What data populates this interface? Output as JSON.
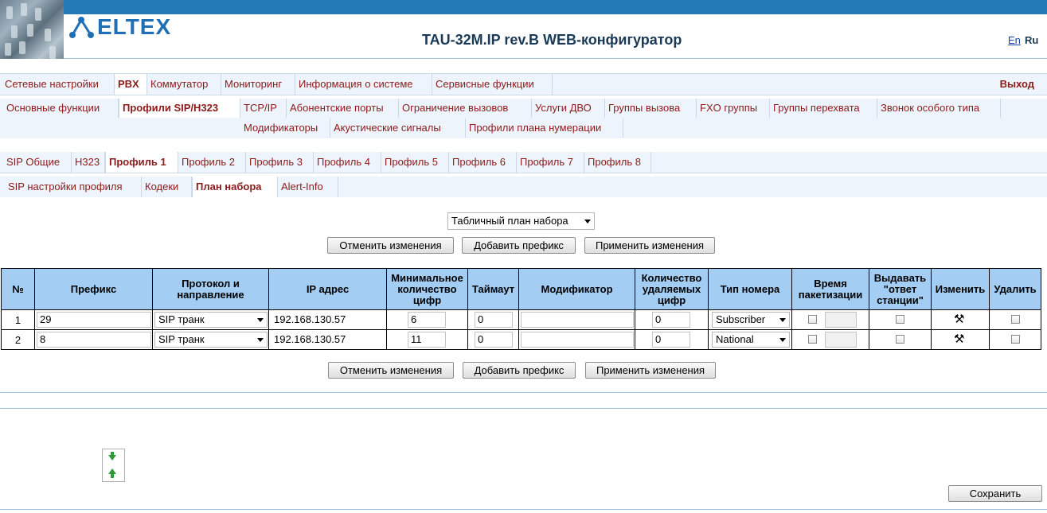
{
  "header": {
    "logo_text": "ELTEX",
    "title": "TAU-32M.IP rev.B WEB-конфигуратор",
    "lang_en": "En",
    "lang_ru": "Ru"
  },
  "main_nav": {
    "items": [
      "Сетевые настройки",
      "PBX",
      "Коммутатор",
      "Мониторинг",
      "Информация о системе",
      "Сервисные функции"
    ],
    "active": "PBX",
    "exit": "Выход"
  },
  "sub_nav": {
    "items": [
      "Основные функции",
      "Профили SIP/H323",
      "TCP/IP",
      "Абонентские порты",
      "Ограничение вызовов",
      "Услуги ДВО",
      "Группы вызова",
      "FXO группы",
      "Группы перехвата",
      "Звонок особого типа",
      "Модификаторы",
      "Акустические сигналы",
      "Профили плана нумерации"
    ],
    "active": "Профили SIP/H323"
  },
  "profile_tabs": {
    "items": [
      "SIP Общие",
      "H323",
      "Профиль 1",
      "Профиль 2",
      "Профиль 3",
      "Профиль 4",
      "Профиль 5",
      "Профиль 6",
      "Профиль 7",
      "Профиль 8"
    ],
    "active": "Профиль 1"
  },
  "profile_subtabs": {
    "items": [
      "SIP настройки профиля",
      "Кодеки",
      "План набора",
      "Alert-Info"
    ],
    "active": "План набора"
  },
  "dialplan_select": {
    "value": "Табличный план набора"
  },
  "buttons": {
    "cancel": "Отменить изменения",
    "add": "Добавить префикс",
    "apply": "Применить изменения",
    "save": "Сохранить"
  },
  "table": {
    "headers": {
      "num": "№",
      "prefix": "Префикс",
      "protocol": "Протокол и направление",
      "ip": "IP адрес",
      "min_digits": "Минимальное количество цифр",
      "timeout": "Таймаут",
      "modifier": "Модификатор",
      "del_digits": "Количество удаляемых цифр",
      "number_type": "Тип номера",
      "ptime": "Время пакетизации",
      "answer": "Выдавать \"ответ станции\"",
      "edit": "Изменить",
      "delete": "Удалить"
    },
    "rows": [
      {
        "num": "1",
        "prefix": "29",
        "protocol": "SIP транк",
        "ip": "192.168.130.57",
        "min_digits": "6",
        "timeout": "0",
        "modifier": "",
        "del_digits": "0",
        "number_type": "Subscriber",
        "ptime": "",
        "answer": false,
        "delete": false
      },
      {
        "num": "2",
        "prefix": "8",
        "protocol": "SIP транк",
        "ip": "192.168.130.57",
        "min_digits": "11",
        "timeout": "0",
        "modifier": "",
        "del_digits": "0",
        "number_type": "National",
        "ptime": "",
        "answer": false,
        "delete": false
      }
    ]
  },
  "icons": {
    "edit": "hammer-wrench-icon",
    "scroll_down": "arrow-down-icon",
    "scroll_up": "arrow-up-icon"
  },
  "colors": {
    "topbar": "#2479b7",
    "nav_text": "#8b1a1a",
    "table_header": "#a3cdf2",
    "title": "#1b3a57",
    "logo": "#1e6fb5"
  }
}
